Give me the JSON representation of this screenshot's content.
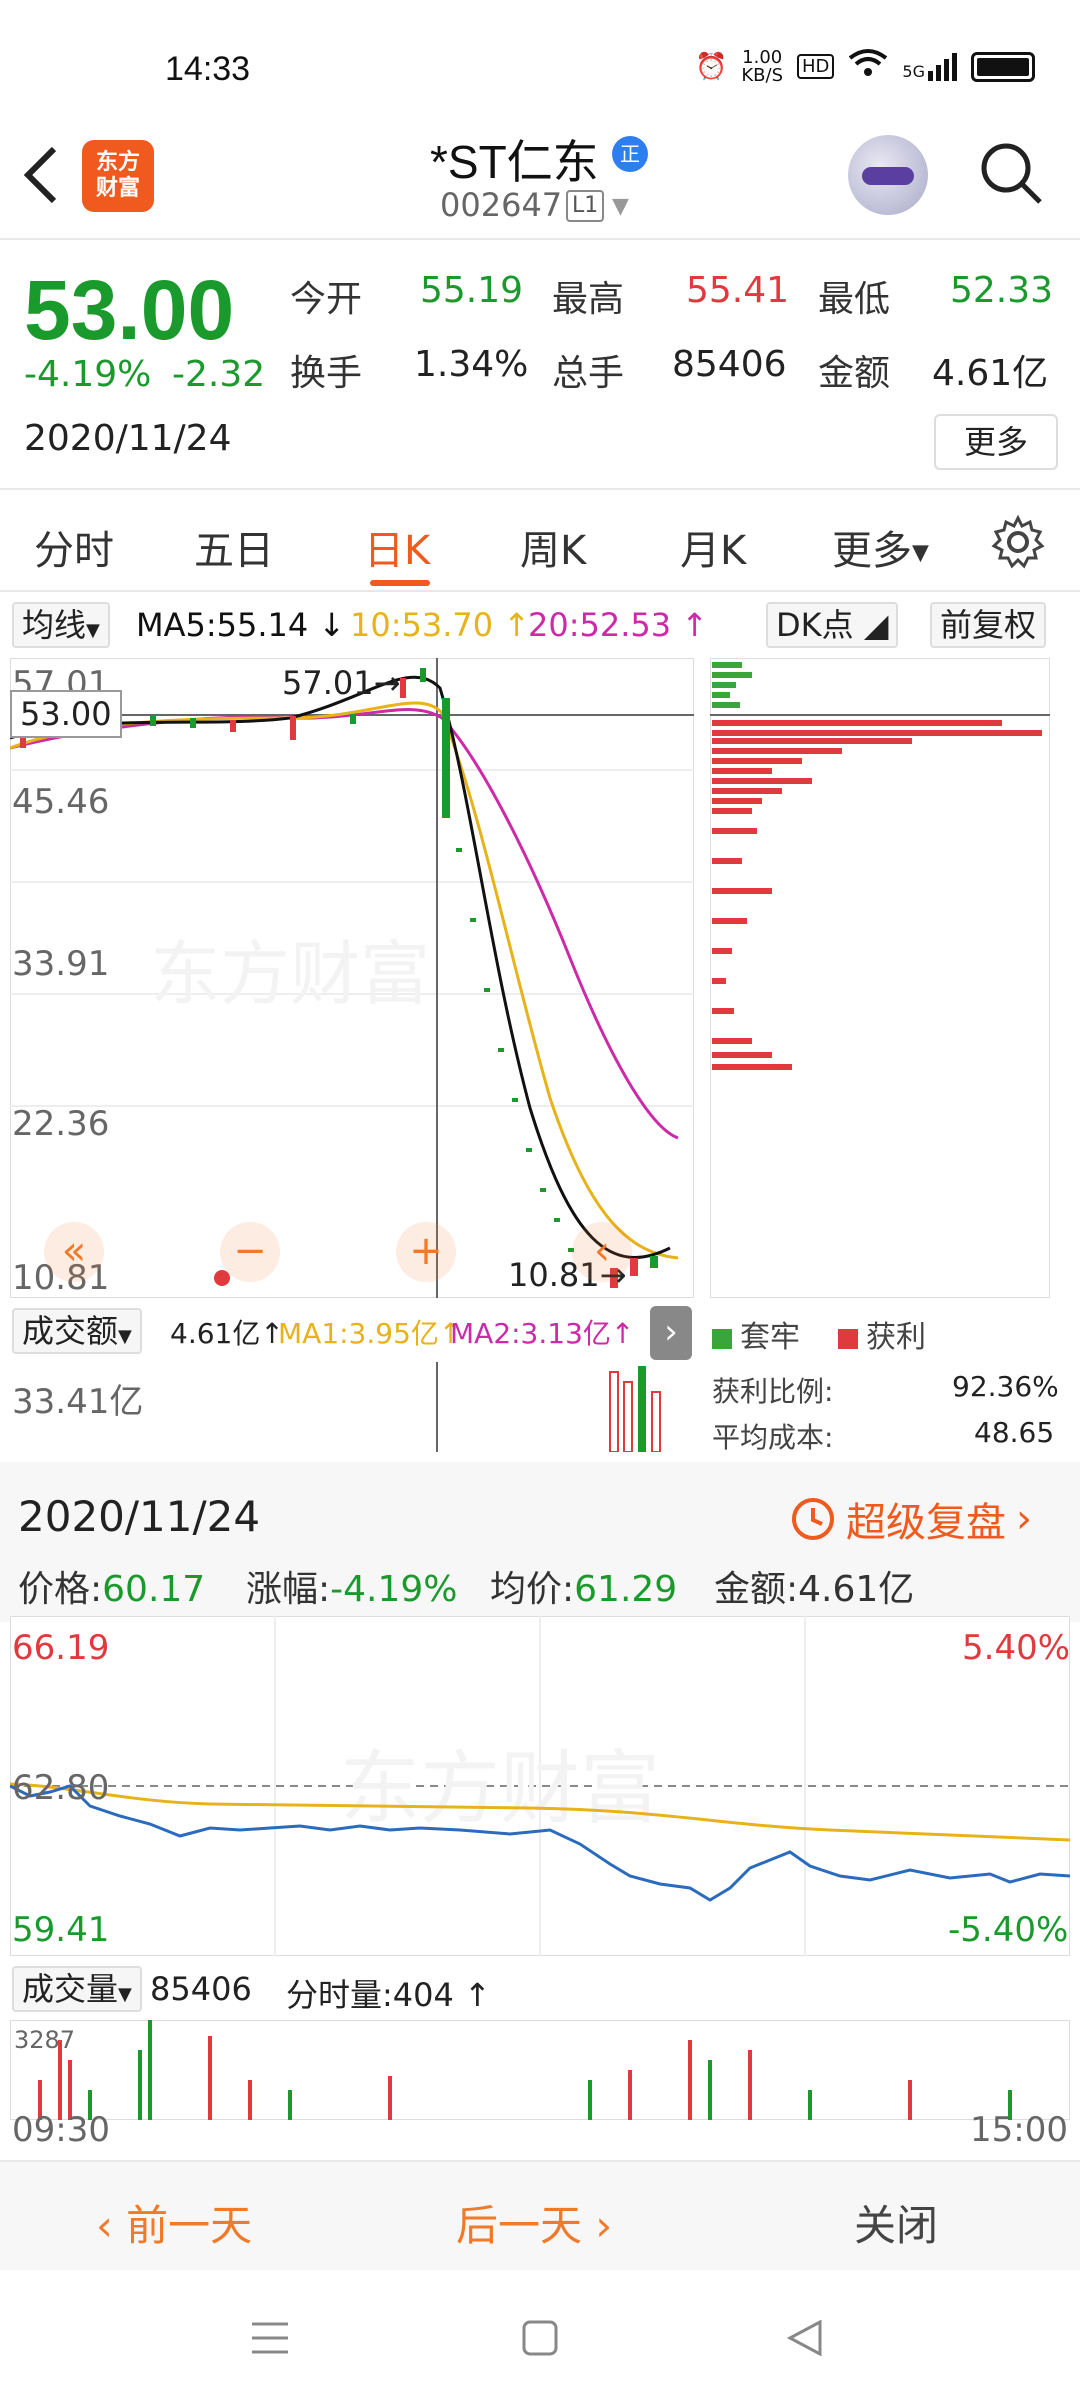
{
  "status_bar": {
    "time": "14:33",
    "net_speed_top": "1.00",
    "net_speed_bottom": "KB/S",
    "hd": "HD",
    "network": "5G"
  },
  "header": {
    "app_logo_text": "东方\n财富",
    "stock_name": "*ST仁东",
    "badge": "正",
    "stock_code": "002647",
    "level": "L1"
  },
  "quote": {
    "price": "53.00",
    "change_pct": "-4.19%",
    "change_amt": "-2.32",
    "date": "2020/11/24",
    "open_label": "今开",
    "open": "55.19",
    "high_label": "最高",
    "high": "55.41",
    "low_label": "最低",
    "low": "52.33",
    "turnover_label": "换手",
    "turnover": "1.34%",
    "volume_label": "总手",
    "volume": "85406",
    "amount_label": "金额",
    "amount": "4.61亿",
    "more_label": "更多"
  },
  "period_tabs": [
    "分时",
    "五日",
    "日K",
    "周K",
    "月K",
    "更多"
  ],
  "active_tab": "日K",
  "indicators": {
    "ma_selector": "均线",
    "ma5": "MA5:55.14",
    "ma10": "10:53.70",
    "ma20": "20:52.53",
    "dk": "DK点",
    "adjust": "前复权"
  },
  "kline": {
    "y_labels": [
      "57.01",
      "45.46",
      "33.91",
      "22.36",
      "10.81"
    ],
    "high_annotation": "57.01",
    "low_annotation": "10.81",
    "current_price_tag": "53.00",
    "watermark": "东方财富"
  },
  "volume_panel": {
    "selector": "成交额",
    "amount": "4.61亿",
    "ma1": "MA1:3.95亿",
    "ma2": "MA2:3.13亿",
    "max_label": "33.41亿"
  },
  "chip": {
    "legend_trapped": "套牢",
    "legend_profit": "获利",
    "profit_ratio_label": "获利比例:",
    "profit_ratio": "92.36%",
    "avg_cost_label": "平均成本:",
    "avg_cost": "48.65"
  },
  "review": {
    "date": "2020/11/24",
    "link": "超级复盘",
    "price_label": "价格:",
    "price": "60.17",
    "change_label": "涨幅:",
    "change": "-4.19%",
    "avg_label": "均价:",
    "avg": "61.29",
    "amount_label": "金额:",
    "amount": "4.61亿"
  },
  "intraday": {
    "y_top": "66.19",
    "y_mid": "62.80",
    "y_bottom": "59.41",
    "pct_top": "5.40%",
    "pct_bottom": "-5.40%",
    "volume_selector": "成交量",
    "volume": "85406",
    "tick_volume": "分时量:404",
    "vol_max": "3287",
    "time_start": "09:30",
    "time_end": "15:00"
  },
  "day_nav": {
    "prev": "前一天",
    "next": "后一天",
    "close": "关闭"
  },
  "colors": {
    "up": "#e0393e",
    "down": "#1a9a2c",
    "accent": "#f05a1e",
    "ma5": "#111111",
    "ma10": "#e8b21a",
    "ma20": "#cc2aa8"
  }
}
